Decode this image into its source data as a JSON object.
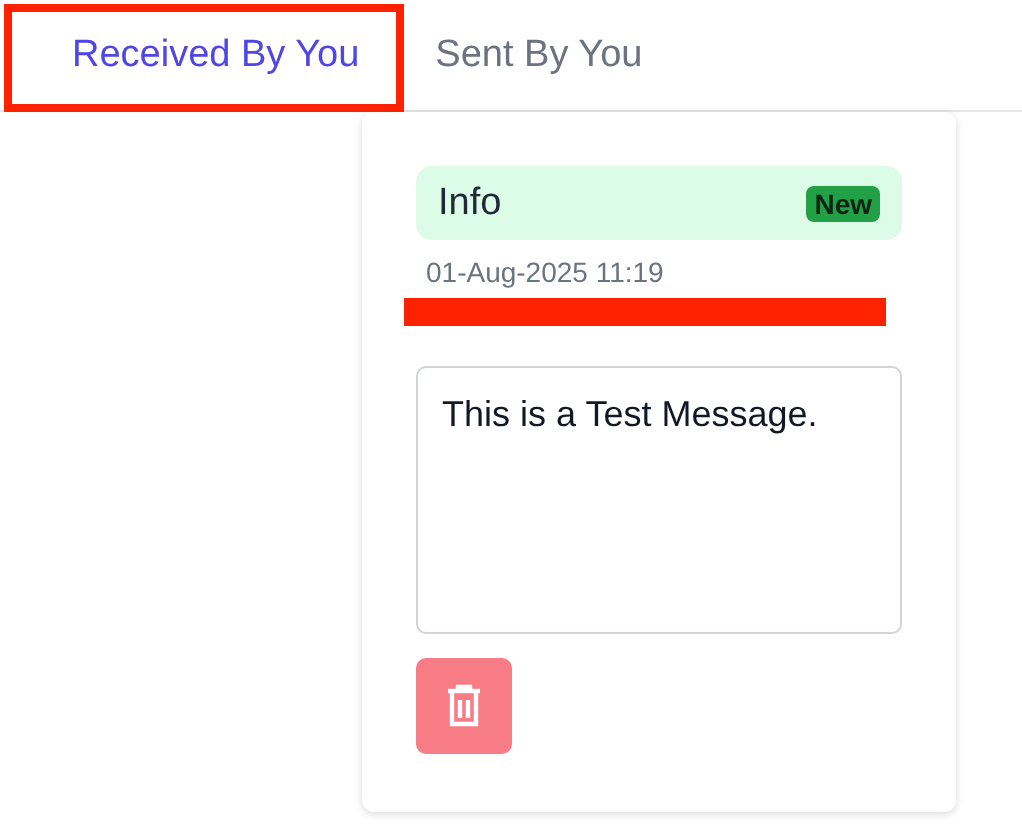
{
  "tabs": [
    {
      "label": "Received By You",
      "selected": true,
      "highlighted": true
    },
    {
      "label": "Sent By You",
      "selected": false,
      "highlighted": false
    }
  ],
  "message": {
    "category": "Info",
    "badge": "New",
    "date": "01-Aug-2025 11:19",
    "sender_redacted": true,
    "body": "This is a Test Message."
  }
}
